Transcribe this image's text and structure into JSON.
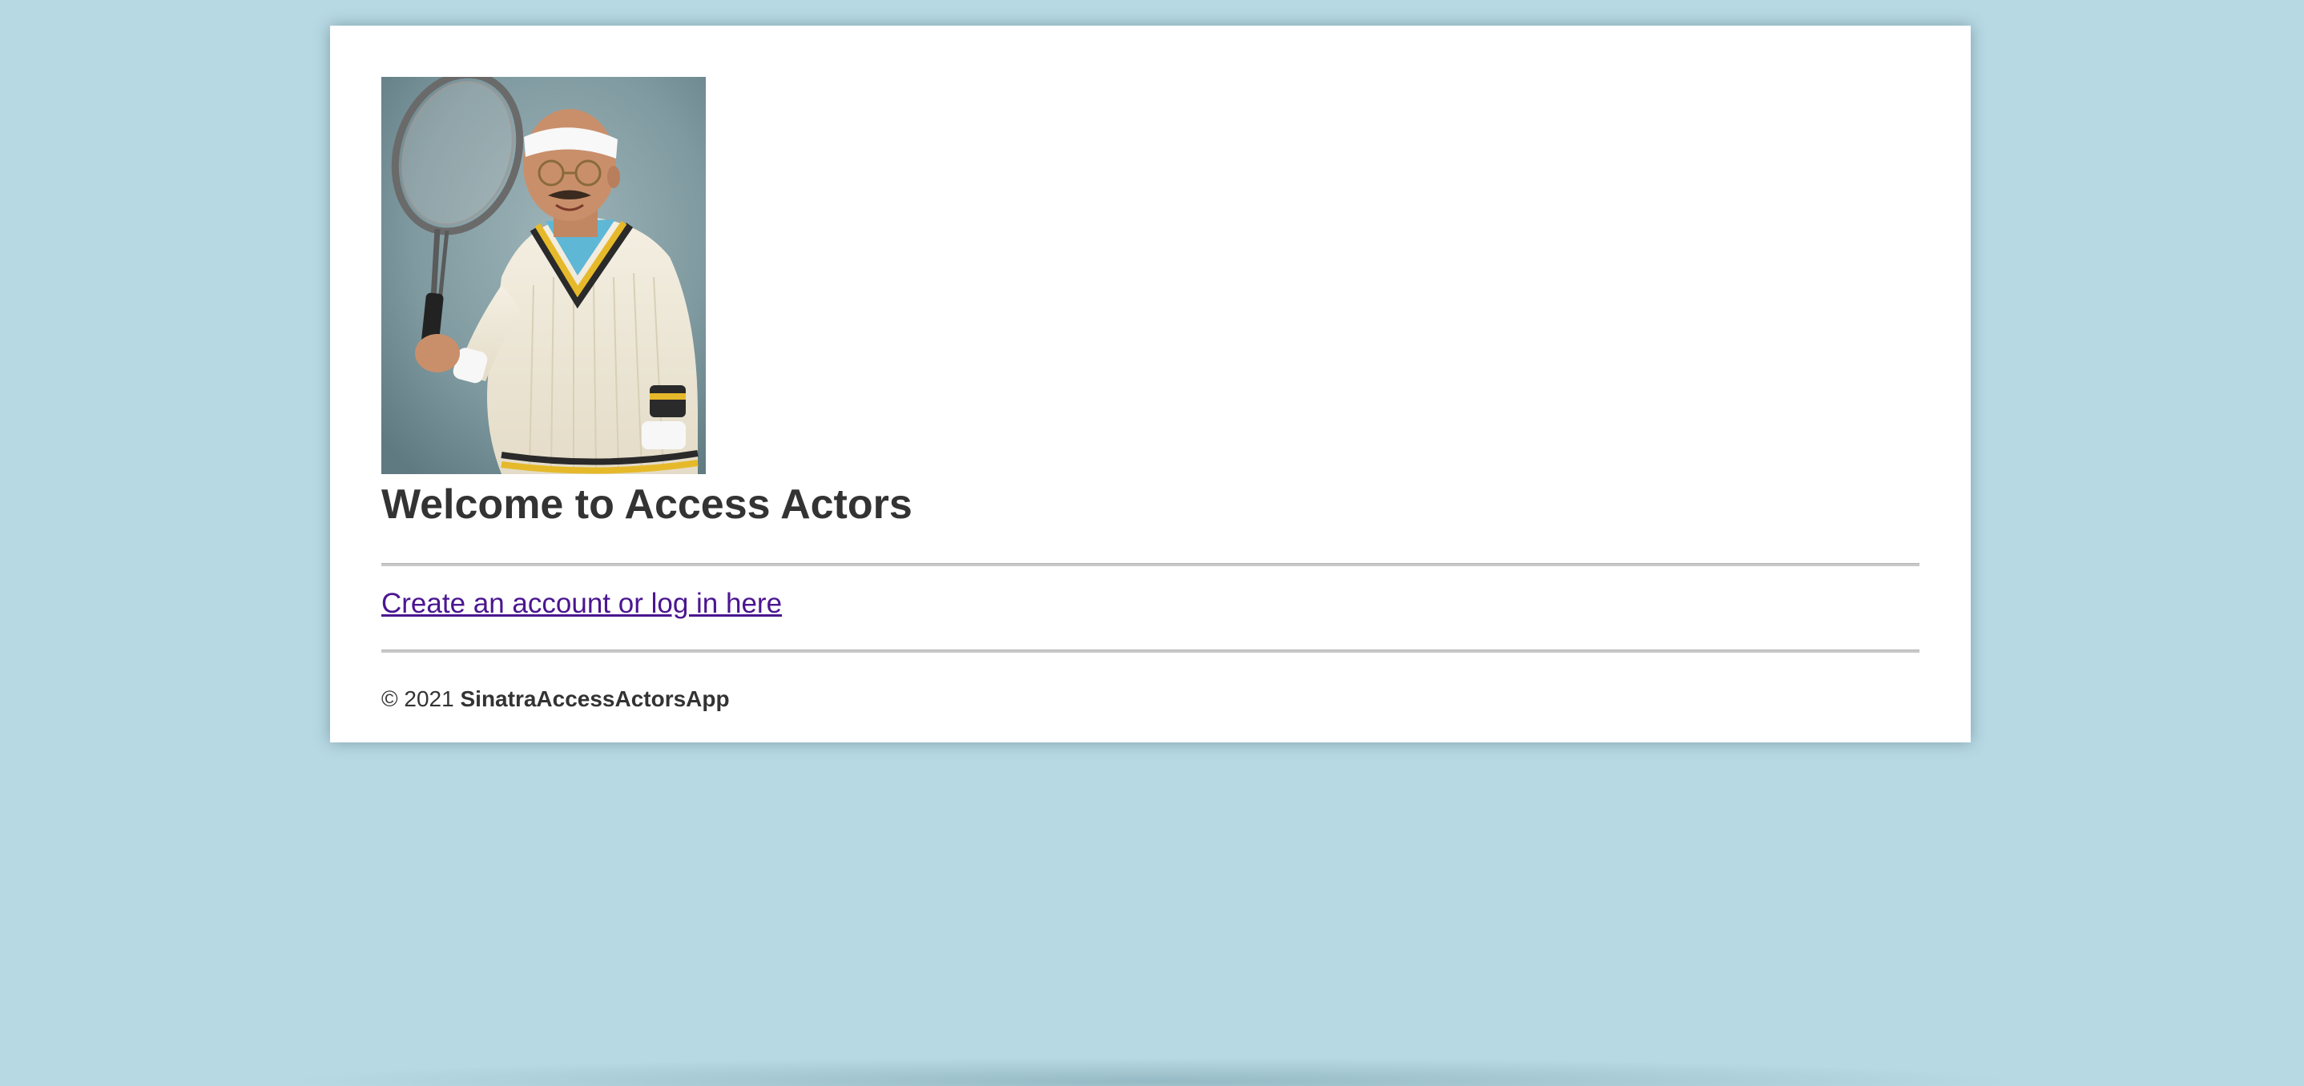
{
  "portrait": {
    "alt": "Portrait of a man in a headband holding a tennis racket"
  },
  "heading": {
    "title": "Welcome to Access Actors"
  },
  "link": {
    "label": "Create an account or log in here"
  },
  "footer": {
    "copyright": "© 2021",
    "app_name": "SinatraAccessActorsApp"
  },
  "colors": {
    "background": "#b7d9e4",
    "card": "#ffffff",
    "link": "#4b1690",
    "text": "#333333"
  }
}
